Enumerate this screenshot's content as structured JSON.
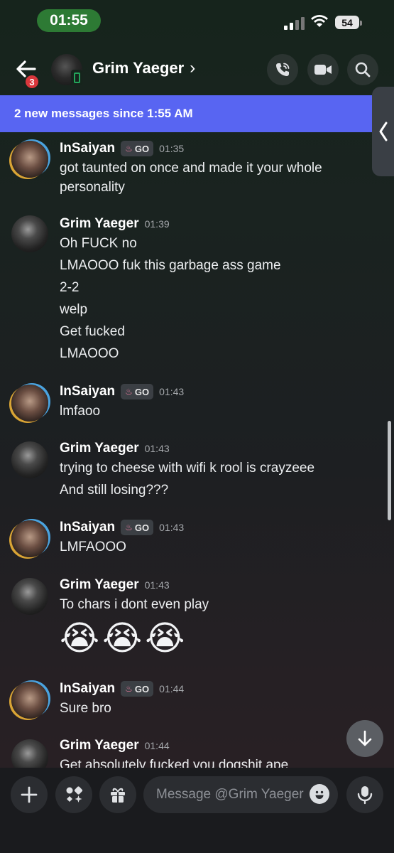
{
  "status_bar": {
    "time": "01:55",
    "battery": "54"
  },
  "header": {
    "title": "Grim Yaeger",
    "chevron": "›",
    "unread_badge": "3"
  },
  "banner": {
    "text": "2 new messages since 1:55 AM"
  },
  "messages": [
    {
      "author": "InSaiyan",
      "tag": "GO",
      "time": "01:35",
      "lines": [
        "got taunted on once and made it your whole",
        "personality"
      ]
    },
    {
      "author": "Grim Yaeger",
      "time": "01:39",
      "lines": [
        "Oh FUCK no",
        "LMAOOO fuk this garbage ass game",
        "2-2",
        "welp",
        "Get fucked",
        "LMAOOO"
      ]
    },
    {
      "author": "InSaiyan",
      "tag": "GO",
      "time": "01:43",
      "lines": [
        "lmfaoo"
      ]
    },
    {
      "author": "Grim Yaeger",
      "time": "01:43",
      "lines": [
        "trying to cheese with wifi k rool is crayzeee",
        "And still losing???"
      ]
    },
    {
      "author": "InSaiyan",
      "tag": "GO",
      "time": "01:43",
      "lines": [
        "LMFAOOO"
      ]
    },
    {
      "author": "Grim Yaeger",
      "time": "01:43",
      "lines": [
        "To chars i dont even play"
      ],
      "emojis": [
        "😭",
        "😭",
        "😭"
      ]
    },
    {
      "author": "InSaiyan",
      "tag": "GO",
      "time": "01:44",
      "lines": [
        "Sure bro"
      ]
    },
    {
      "author": "Grim Yaeger",
      "time": "01:44",
      "lines": [
        "Get absolutely fucked you dogshit ape"
      ]
    }
  ],
  "composer": {
    "placeholder": "Message @Grim Yaeger"
  },
  "icons": {
    "back": "arrow-left-icon",
    "call": "phone-call-icon",
    "video": "video-camera-icon",
    "search": "search-icon",
    "plus": "plus-icon",
    "apps": "apps-icon",
    "gift": "gift-icon",
    "emoji": "emoji-icon",
    "mic": "microphone-icon",
    "jump": "arrow-down-icon",
    "nitro": "nitro-flame-icon"
  },
  "colors": {
    "banner": "#5865f2",
    "time_pill": "#2d7a34",
    "badge": "#da373c",
    "online_mobile": "#23a55a"
  }
}
